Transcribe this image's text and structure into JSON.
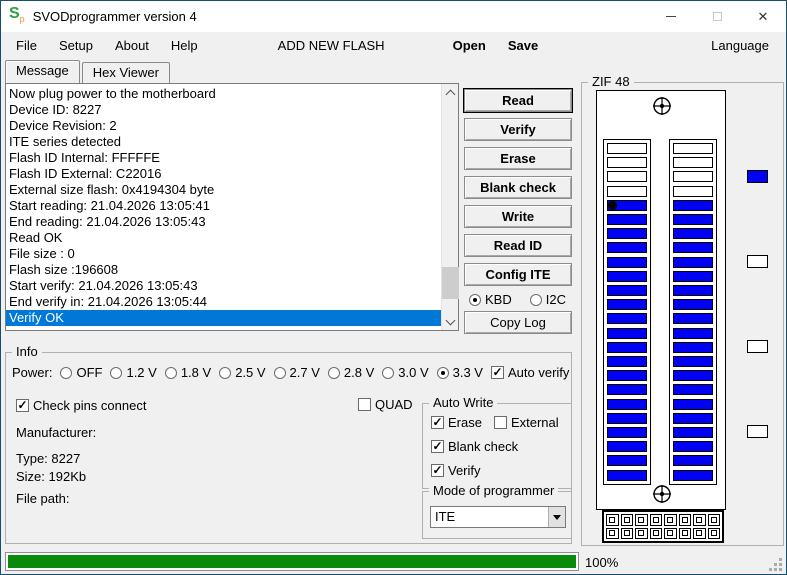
{
  "window": {
    "title": "SVODprogrammer version 4"
  },
  "icon": {
    "letter": "S",
    "sub": "p",
    "color": "#2ba33c",
    "sub_color": "#e09a3e"
  },
  "menu": {
    "file": "File",
    "setup": "Setup",
    "about": "About",
    "help": "Help",
    "add_new_flash": "ADD NEW FLASH",
    "open": "Open",
    "save": "Save",
    "language": "Language"
  },
  "tabs": {
    "message": "Message",
    "hex_viewer": "Hex Viewer"
  },
  "log": {
    "lines": [
      "Now plug power to the motherboard",
      "Device ID: 8227",
      "Device Revision: 2",
      "ITE series detected",
      "Flash ID Internal: FFFFFE",
      "Flash ID External: C22016",
      "External size flash: 0x4194304 byte",
      "Start reading: 21.04.2026 13:05:41",
      "End reading: 21.04.2026 13:05:43",
      "Read OK",
      "File size : 0",
      "Flash size :196608",
      "Start verify: 21.04.2026 13:05:43",
      "End verify in: 21.04.2026 13:05:44",
      "Verify OK"
    ],
    "selected_index": 14,
    "selection_color": "#0078d7"
  },
  "actions": {
    "read": "Read",
    "verify": "Verify",
    "erase": "Erase",
    "blank_check": "Blank check",
    "write": "Write",
    "read_id": "Read ID",
    "config_ite": "Config ITE",
    "copy_log": "Copy Log",
    "bus_radios": [
      {
        "label": "KBD",
        "checked": true
      },
      {
        "label": "I2C",
        "checked": false
      }
    ]
  },
  "info": {
    "title": "Info",
    "power_label": "Power:",
    "power_options": [
      {
        "label": "OFF",
        "checked": false
      },
      {
        "label": "1.2 V",
        "checked": false
      },
      {
        "label": "1.8 V",
        "checked": false
      },
      {
        "label": "2.5 V",
        "checked": false
      },
      {
        "label": "2.7 V",
        "checked": false
      },
      {
        "label": "2.8 V",
        "checked": false
      },
      {
        "label": "3.0 V",
        "checked": false
      },
      {
        "label": "3.3 V",
        "checked": true
      }
    ],
    "auto_verify": {
      "label": "Auto verify",
      "checked": true
    },
    "check_pins": {
      "label": "Check pins connect",
      "checked": true
    },
    "quad": {
      "label": "QUAD",
      "checked": false
    },
    "fields": {
      "manufacturer": {
        "label": "Manufacturer:",
        "value": ""
      },
      "type": {
        "label": "Type:",
        "value": "8227"
      },
      "size": {
        "label": "Size:",
        "value": "192Kb"
      },
      "file_path": {
        "label": "File path:",
        "value": ""
      }
    },
    "auto_write": {
      "title": "Auto Write",
      "options": [
        {
          "label": "Erase",
          "checked": true
        },
        {
          "label": "External",
          "checked": false
        },
        {
          "label": "Blank check",
          "checked": true
        },
        {
          "label": "Verify",
          "checked": true
        }
      ]
    },
    "mode": {
      "title": "Mode of programmer",
      "value": "ITE"
    }
  },
  "zif": {
    "title": "ZIF 48",
    "slots_per_column": 24,
    "empty_top_slots": 4,
    "pin1_marker_column": 0,
    "pin1_marker_slot": 4,
    "active_color": "#0202f2",
    "empty_color": "#ffffff",
    "legend_swatches": [
      {
        "color": "#0202f2"
      },
      {
        "color": "#ffffff"
      },
      {
        "color": "#ffffff"
      },
      {
        "color": "#ffffff"
      }
    ],
    "connector": {
      "rows": 2,
      "cols": 8
    }
  },
  "statusbar": {
    "progress_percent": 100,
    "label": "100%",
    "bar_color": "#0a8a0a"
  }
}
